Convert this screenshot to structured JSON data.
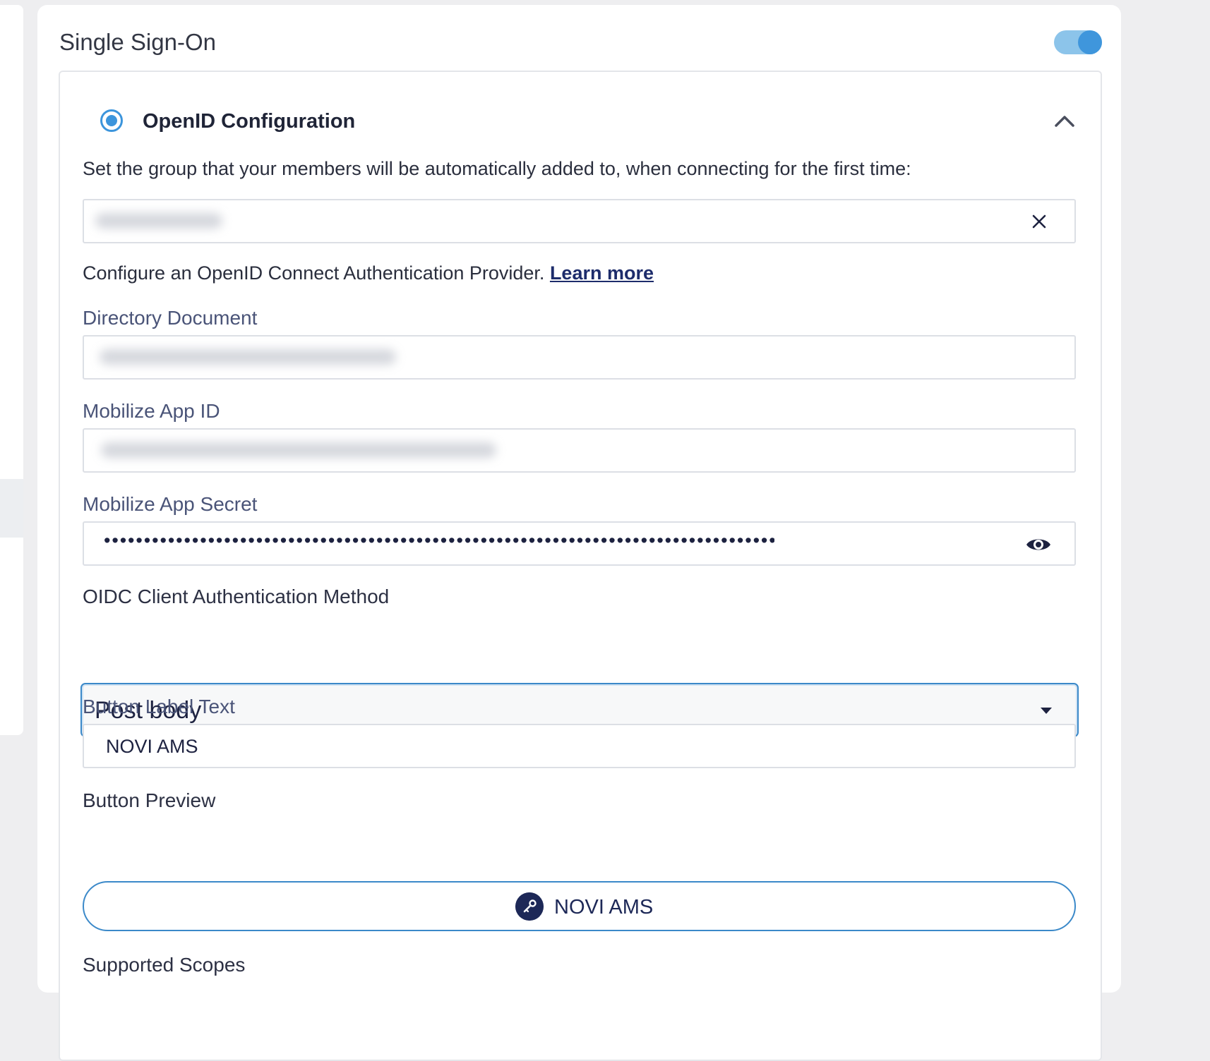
{
  "card": {
    "title": "Single Sign-On",
    "toggle_on": true
  },
  "openid": {
    "title": "OpenID Configuration",
    "selected": true,
    "group_instructions": "Set the group that your members will be automatically added to, when connecting for the first time:",
    "configure_text": "Configure an OpenID Connect Authentication Provider.",
    "learn_more": "Learn more",
    "fields": {
      "directory_document": {
        "label": "Directory Document"
      },
      "app_id": {
        "label": "Mobilize App ID"
      },
      "app_secret": {
        "label": "Mobilize App Secret",
        "masked_value": "•••••••••••••••••••••••••••••••••••••••••••••••••••••••••••••••••••••••••••••••••••••••••"
      },
      "auth_method": {
        "label": "OIDC Client Authentication Method",
        "selected": "Post body"
      },
      "button_label": {
        "label": "Button Label Text",
        "value": "NOVI AMS"
      },
      "button_preview": {
        "label": "Button Preview",
        "text": "NOVI AMS"
      },
      "supported_scopes": {
        "label": "Supported Scopes"
      }
    }
  },
  "colors": {
    "accent": "#3c95dc",
    "navy": "#1d2857",
    "label": "#4a5478"
  },
  "icons": [
    "close-icon",
    "eye-icon",
    "chevron-up-icon",
    "caret-down-icon",
    "key-icon"
  ]
}
